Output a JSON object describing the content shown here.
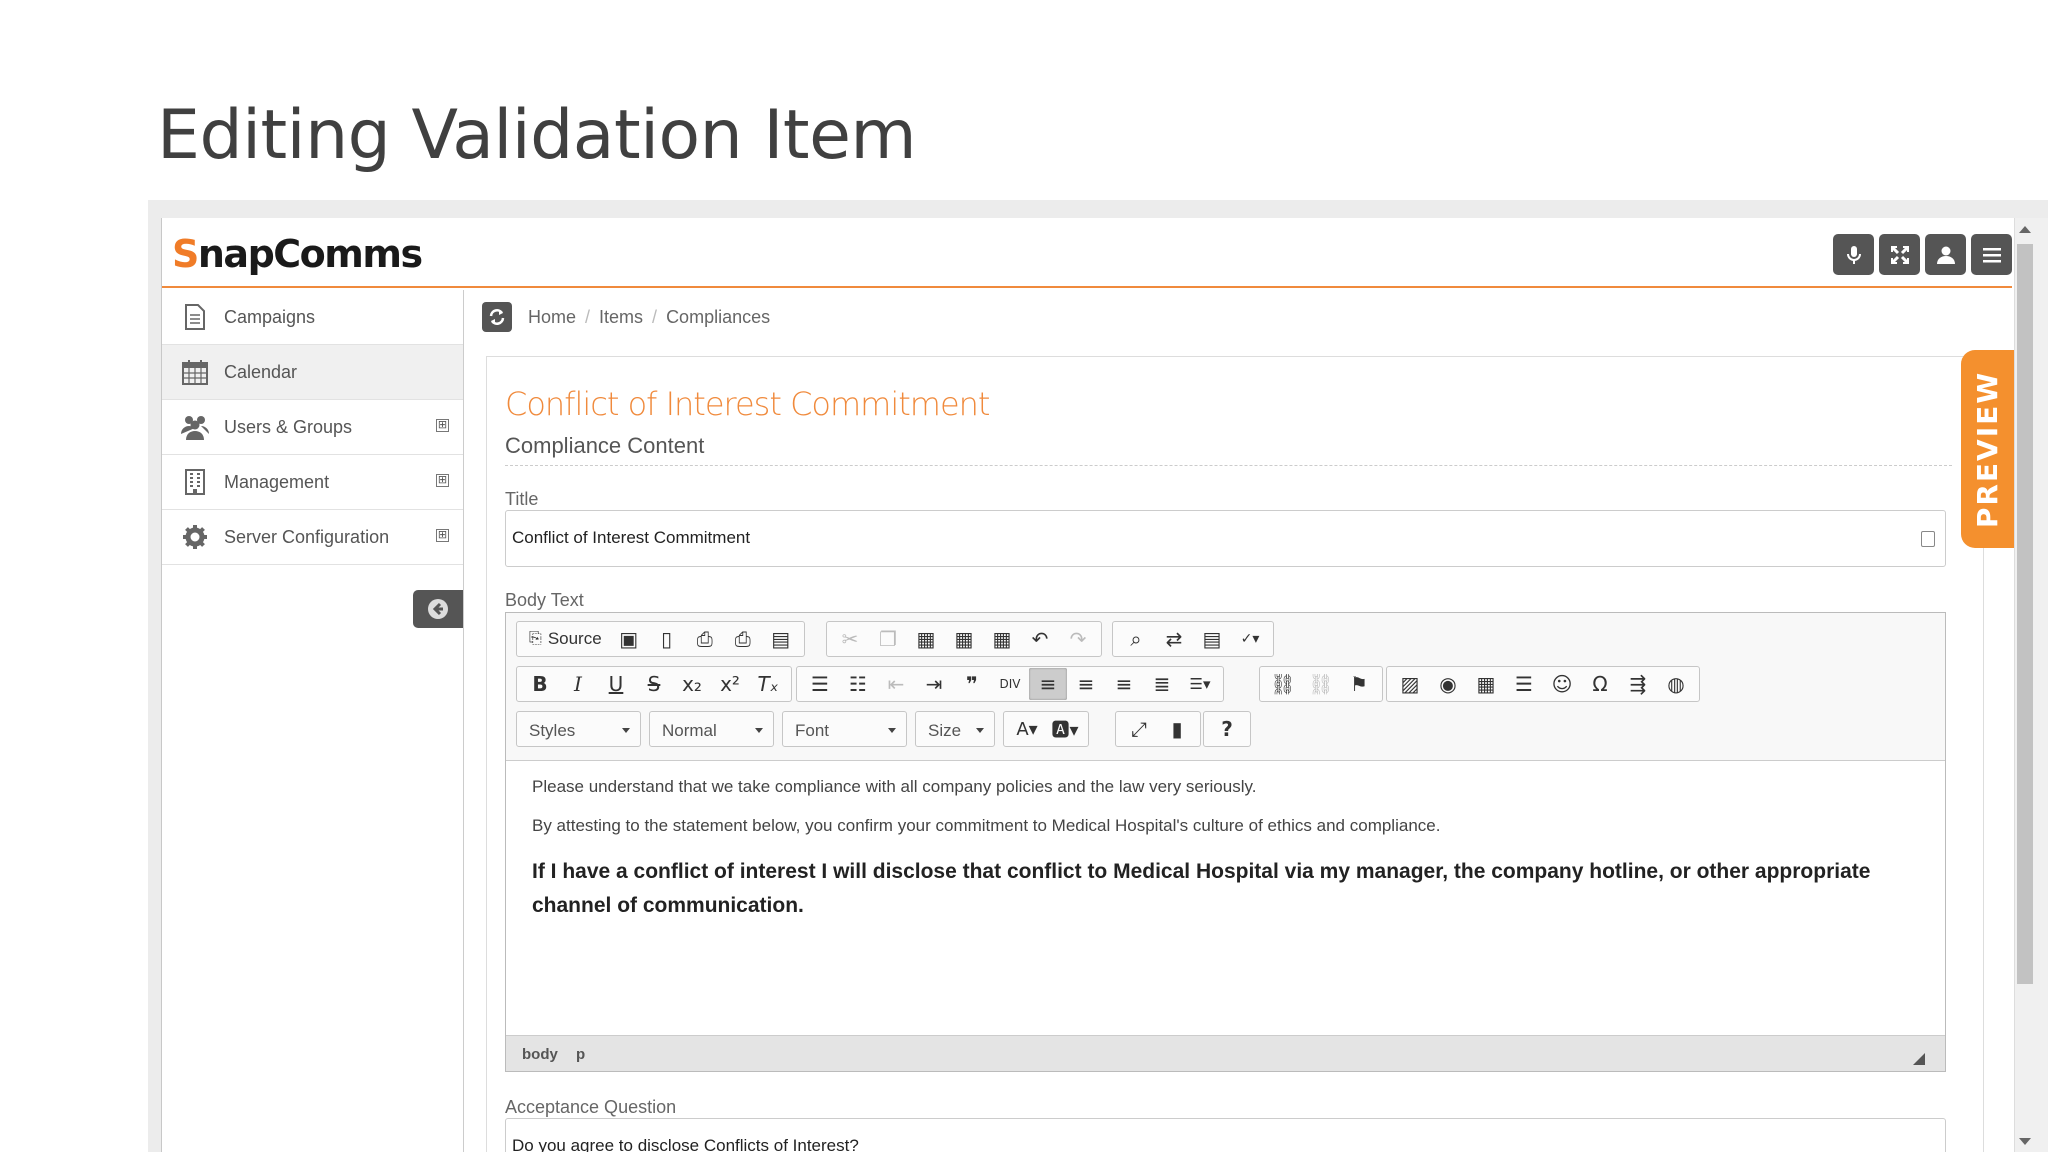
{
  "slide": {
    "title": "Editing Validation Item"
  },
  "app": {
    "brand_first": "S",
    "brand_rest": "napComms",
    "accent_color": "#f08a3c",
    "top_icons": [
      "microphone-icon",
      "fullscreen-icon",
      "user-icon",
      "menu-icon"
    ]
  },
  "sidebar": {
    "items": [
      {
        "label": "Campaigns",
        "icon": "document-icon",
        "expandable": false
      },
      {
        "label": "Calendar",
        "icon": "calendar-icon",
        "expandable": false,
        "active": true
      },
      {
        "label": "Users & Groups",
        "icon": "users-icon",
        "expandable": true
      },
      {
        "label": "Management",
        "icon": "building-icon",
        "expandable": true
      },
      {
        "label": "Server Configuration",
        "icon": "gear-icon",
        "expandable": true
      }
    ],
    "expand_symbol": "⊞"
  },
  "breadcrumb": {
    "home": "Home",
    "items": "Items",
    "current": "Compliances",
    "sep": "/"
  },
  "panel": {
    "title": "Conflict of Interest Commitment",
    "subtitle": "Compliance Content",
    "title_label": "Title",
    "title_value": "Conflict of Interest Commitment",
    "body_label": "Body Text",
    "acceptance_label": "Acceptance Question",
    "acceptance_value": "Do you agree to disclose Conflicts of Interest?"
  },
  "editor": {
    "source_label": "Source",
    "styles_label": "Styles",
    "format_label": "Normal",
    "font_label": "Font",
    "size_label": "Size",
    "paragraph1": "Please understand that we take compliance with all company policies and the law very seriously.",
    "paragraph2": "By attesting to the statement below, you confirm your commitment to Medical Hospital's culture of ethics and compliance.",
    "paragraph3": "If I have a conflict of interest I will disclose that conflict to Medical Hospital via my manager, the company hotline, or other appropriate channel of communication.",
    "path_body": "body",
    "path_p": "p"
  },
  "preview_tab": {
    "label": "PREVIEW",
    "color": "#f4902e"
  }
}
